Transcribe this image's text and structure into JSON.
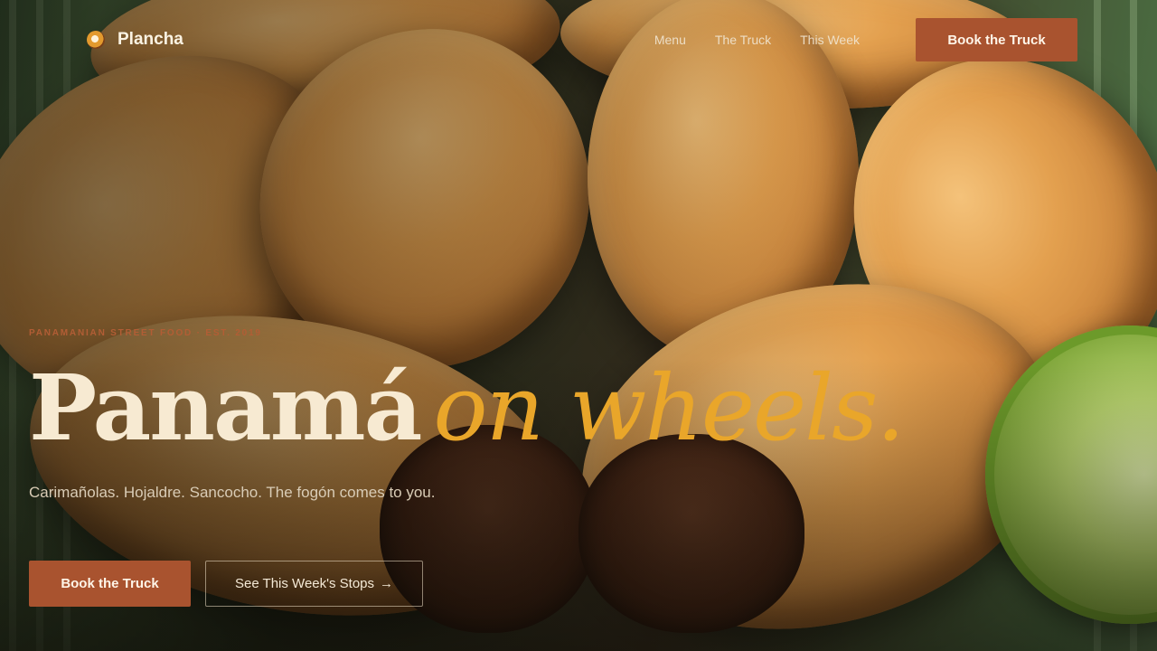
{
  "nav": {
    "brand": "Plancha",
    "links": [
      "Menu",
      "The Truck",
      "This Week"
    ],
    "cta": "Book the Truck"
  },
  "hero": {
    "eyebrow": "PANAMANIAN STREET FOOD · EST. 2019",
    "headline_bold": "Panamá",
    "headline_italic": "on wheels.",
    "subtitle": "Carimañolas. Hojaldre. Sancocho. The fogón comes to you.",
    "primary_cta": "Book the Truck",
    "secondary_cta": "See This Week's Stops",
    "secondary_arrow": "→"
  },
  "colors": {
    "accent": "#a9532f",
    "highlight": "#e9a62a",
    "cream": "#f7ead2"
  }
}
